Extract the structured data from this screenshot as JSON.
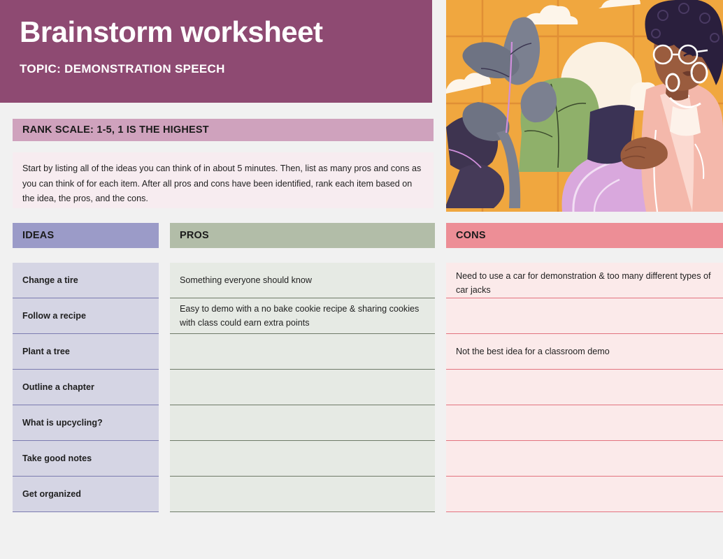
{
  "header": {
    "title": "Brainstorm worksheet",
    "topic": "TOPIC: DEMONSTRATION SPEECH",
    "background_color": "#8e4a72"
  },
  "rank_scale": {
    "label": "RANK SCALE: 1-5, 1 IS THE HIGHEST",
    "background_color": "#cfa2bd"
  },
  "instructions": {
    "text": "Start by listing all of the ideas you can think of in about 5 minutes. Then, list as many pros and cons as you can think of for each item. After all pros and cons have been identified, rank each item based on the idea, the pros, and the cons.",
    "background_color": "#f7ecf0"
  },
  "illustration": {
    "alt": "Illustration of a woman with glasses and afro hair wearing a pink blazer, reading a tablet beside houseplants in front of an orange window",
    "colors": {
      "window": "#f0a73f",
      "plant_green": "#8fb06a",
      "plant_grey": "#7b8090",
      "blazer_pink": "#f4b8ab",
      "skirt_lilac": "#d9a8dd",
      "hair_dark": "#2a1f3d",
      "tablet": "#3b3355",
      "cloud": "#fdf3e6"
    }
  },
  "columns": [
    {
      "id": "ideas",
      "header": "IDEAS",
      "header_color": "#9b9bc8",
      "row_color": "#d5d5e4",
      "divider_color": "#7b7bb0",
      "rows": [
        "Change a tire",
        "Follow a recipe",
        "Plant a tree",
        "Outline a chapter",
        "What is upcycling?",
        "Take good notes",
        "Get organized"
      ]
    },
    {
      "id": "pros",
      "header": "PROS",
      "header_color": "#b2bda8",
      "row_color": "#e6eae4",
      "divider_color": "#6e7a68",
      "rows": [
        "Something everyone should know",
        "Easy to demo with a no bake cookie recipe & sharing cookies with class could earn extra points",
        "",
        "",
        "",
        "",
        ""
      ]
    },
    {
      "id": "cons",
      "header": "CONS",
      "header_color": "#ed8e96",
      "row_color": "#fbeaea",
      "divider_color": "#e2737f",
      "rows": [
        "Need to use a car for demonstration & too many different types of car jacks",
        "",
        "Not the best idea for a classroom demo",
        "",
        "",
        "",
        ""
      ]
    }
  ],
  "page": {
    "background_color": "#f1f1f1"
  }
}
